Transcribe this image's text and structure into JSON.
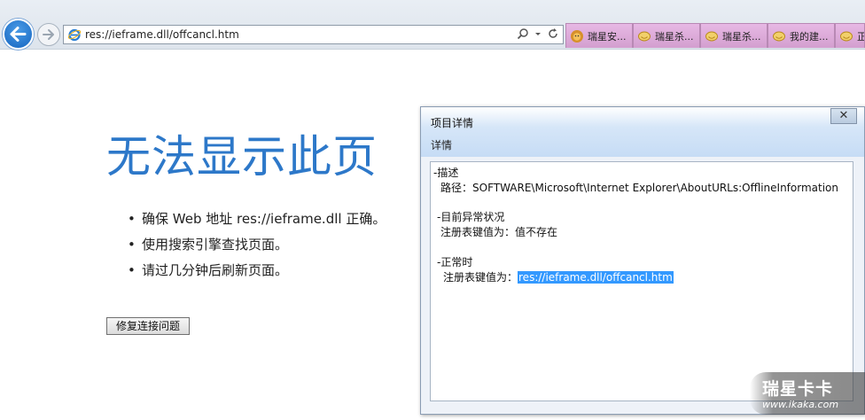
{
  "browser": {
    "url": "res://ieframe.dll/offcancl.htm",
    "tabs": [
      {
        "label": "瑞星安...",
        "icon": "lion-icon"
      },
      {
        "label": "瑞星杀...",
        "icon": "favorite-icon"
      },
      {
        "label": "瑞星杀...",
        "icon": "favorite-icon"
      },
      {
        "label": "我的建...",
        "icon": "favorite-icon"
      },
      {
        "label": "正",
        "icon": "favorite-icon"
      }
    ]
  },
  "error_page": {
    "title": "无法显示此页",
    "bullets": [
      "确保 Web 地址 res://ieframe.dll 正确。",
      "使用搜索引擎查找页面。",
      "请过几分钟后刷新页面。"
    ],
    "fix_button": "修复连接问题"
  },
  "dialog": {
    "title": "项目详情",
    "subtitle": "详情",
    "close_label": "✕",
    "desc_header": "-描述",
    "desc_path": "路径：SOFTWARE\\Microsoft\\Internet Explorer\\AboutURLs:OfflineInformation",
    "current_header": "-目前异常状况",
    "current_value": "注册表键值为：值不存在",
    "normal_header": "-正常时",
    "normal_prefix": "注册表键值为：",
    "normal_value": "res://ieframe.dll/offcancl.htm"
  },
  "watermark": {
    "main": "瑞星卡卡",
    "sub": "www.ikaka.com"
  }
}
